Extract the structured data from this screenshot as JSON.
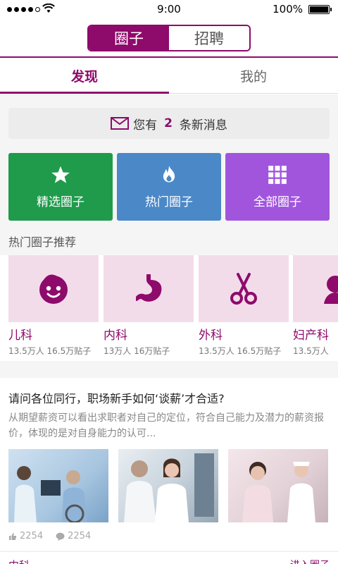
{
  "status": {
    "time": "9:00",
    "battery": "100%"
  },
  "header": {
    "segments": [
      "圈子",
      "招聘"
    ],
    "active_segment": 0
  },
  "tabs": [
    "发现",
    "我的"
  ],
  "message_bar": {
    "prefix": "您有",
    "count": "2",
    "suffix": "条新消息"
  },
  "categories": [
    {
      "label": "精选圈子",
      "icon": "star-icon",
      "color": "#1f9b4b"
    },
    {
      "label": "热门圈子",
      "icon": "flame-icon",
      "color": "#4a88c8"
    },
    {
      "label": "全部圈子",
      "icon": "grid-icon",
      "color": "#a155dd"
    }
  ],
  "hot_section_title": "热门圈子推荐",
  "hot_circles": [
    {
      "name": "儿科",
      "stats": "13.5万人 16.5万贴子",
      "icon": "baby-face-icon"
    },
    {
      "name": "内科",
      "stats": "13万人 16万贴子",
      "icon": "stomach-icon"
    },
    {
      "name": "外科",
      "stats": "13.5万人 16.5万贴子",
      "icon": "scissors-icon"
    },
    {
      "name": "妇产科",
      "stats": "13.5万人",
      "icon": "woman-icon"
    }
  ],
  "article": {
    "title": "请问各位同行，职场新手如何‘谈薪’才合适?",
    "summary": "从期望薪资可以看出求职者对自己的定位，符合自己能力及潜力的薪资报价，体现的是对自身能力的认可...",
    "likes": "2254",
    "comments": "2254"
  },
  "footer": {
    "left": "内科",
    "right": "进入圈子"
  },
  "colors": {
    "brand": "#8e0a6b"
  }
}
